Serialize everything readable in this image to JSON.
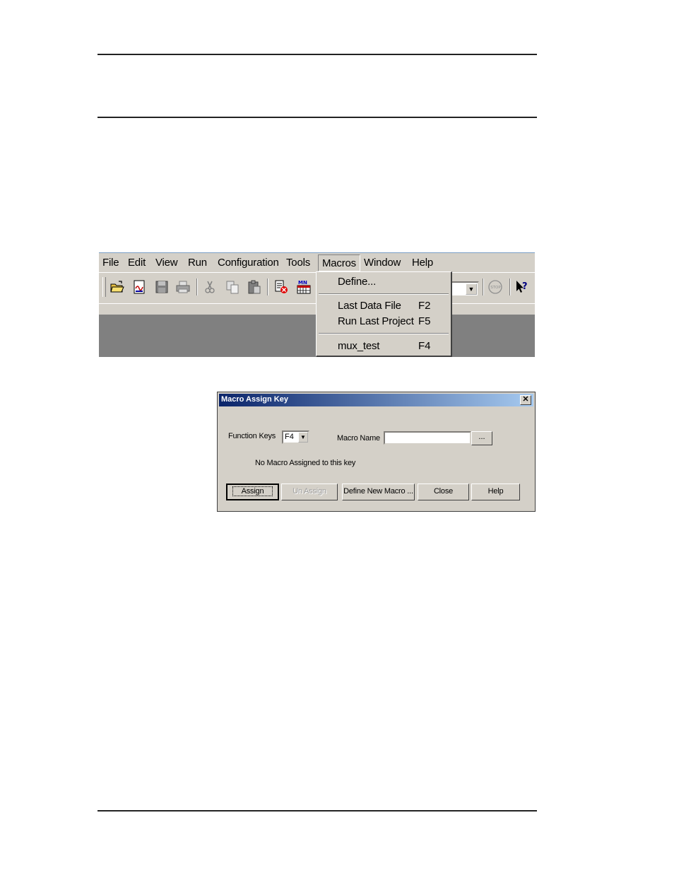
{
  "menubar": {
    "items": [
      "File",
      "Edit",
      "View",
      "Run",
      "Configuration",
      "Tools",
      "Macros",
      "Window",
      "Help"
    ]
  },
  "toolbar": {
    "icons": [
      "open-folder-icon",
      "report-icon",
      "save-icon",
      "print-icon",
      "cut-icon",
      "copy-icon",
      "paste-icon",
      "delete-file-icon",
      "calendar-mn-icon",
      "stop-icon",
      "context-help-icon"
    ]
  },
  "macros_menu": {
    "items": [
      {
        "label": "Define...",
        "key": ""
      },
      {
        "label": "Last Data File",
        "key": "F2"
      },
      {
        "label": "Run Last Project",
        "key": "F5"
      },
      {
        "label": "mux_test",
        "key": "F4"
      }
    ]
  },
  "dialog": {
    "title": "Macro Assign Key",
    "close_glyph": "✕",
    "function_keys_label": "Function Keys",
    "function_key_value": "F4",
    "macro_name_label": "Macro Name",
    "macro_name_value": "",
    "browse_label": "...",
    "status_text": "No Macro Assigned to this key",
    "buttons": {
      "assign": "Assign",
      "unassign": "Un Assign",
      "define_new": "Define New Macro ...",
      "close": "Close",
      "help": "Help"
    }
  }
}
